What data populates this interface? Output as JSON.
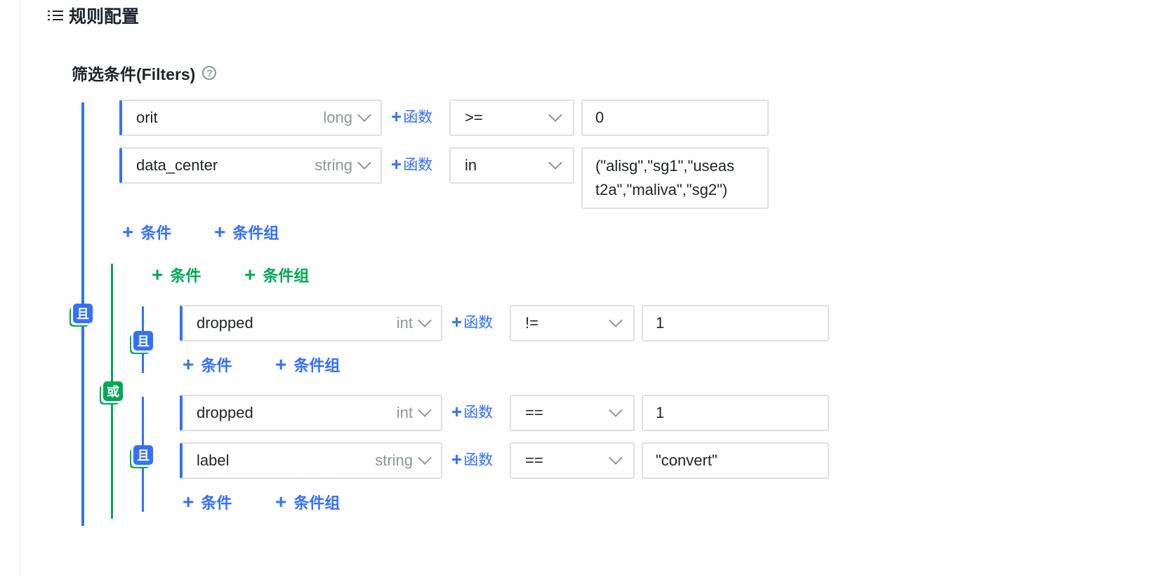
{
  "section": {
    "title": "规则配置"
  },
  "filters": {
    "title": "筛选条件(Filters)",
    "help": "?"
  },
  "labels": {
    "and": "且",
    "or": "或",
    "add_condition": "条件",
    "add_group": "条件组",
    "func": "函数",
    "plus": "+"
  },
  "rows": [
    {
      "field": "orit",
      "type": "long",
      "op": ">=",
      "value": "0"
    },
    {
      "field": "data_center",
      "type": "string",
      "op": "in",
      "value_line1": "(\"alisg\",\"sg1\",\"useas",
      "value_line2": "t2a\",\"maliva\",\"sg2\")"
    },
    {
      "field": "dropped",
      "type": "int",
      "op": "!=",
      "value": "1"
    },
    {
      "field": "dropped",
      "type": "int",
      "op": "==",
      "value": "1"
    },
    {
      "field": "label",
      "type": "string",
      "op": "==",
      "value": "\"convert\""
    }
  ],
  "colors": {
    "primary": "#3370ff",
    "or_green": "#00a854",
    "border": "#dee0e3",
    "muted": "#8f959e"
  }
}
